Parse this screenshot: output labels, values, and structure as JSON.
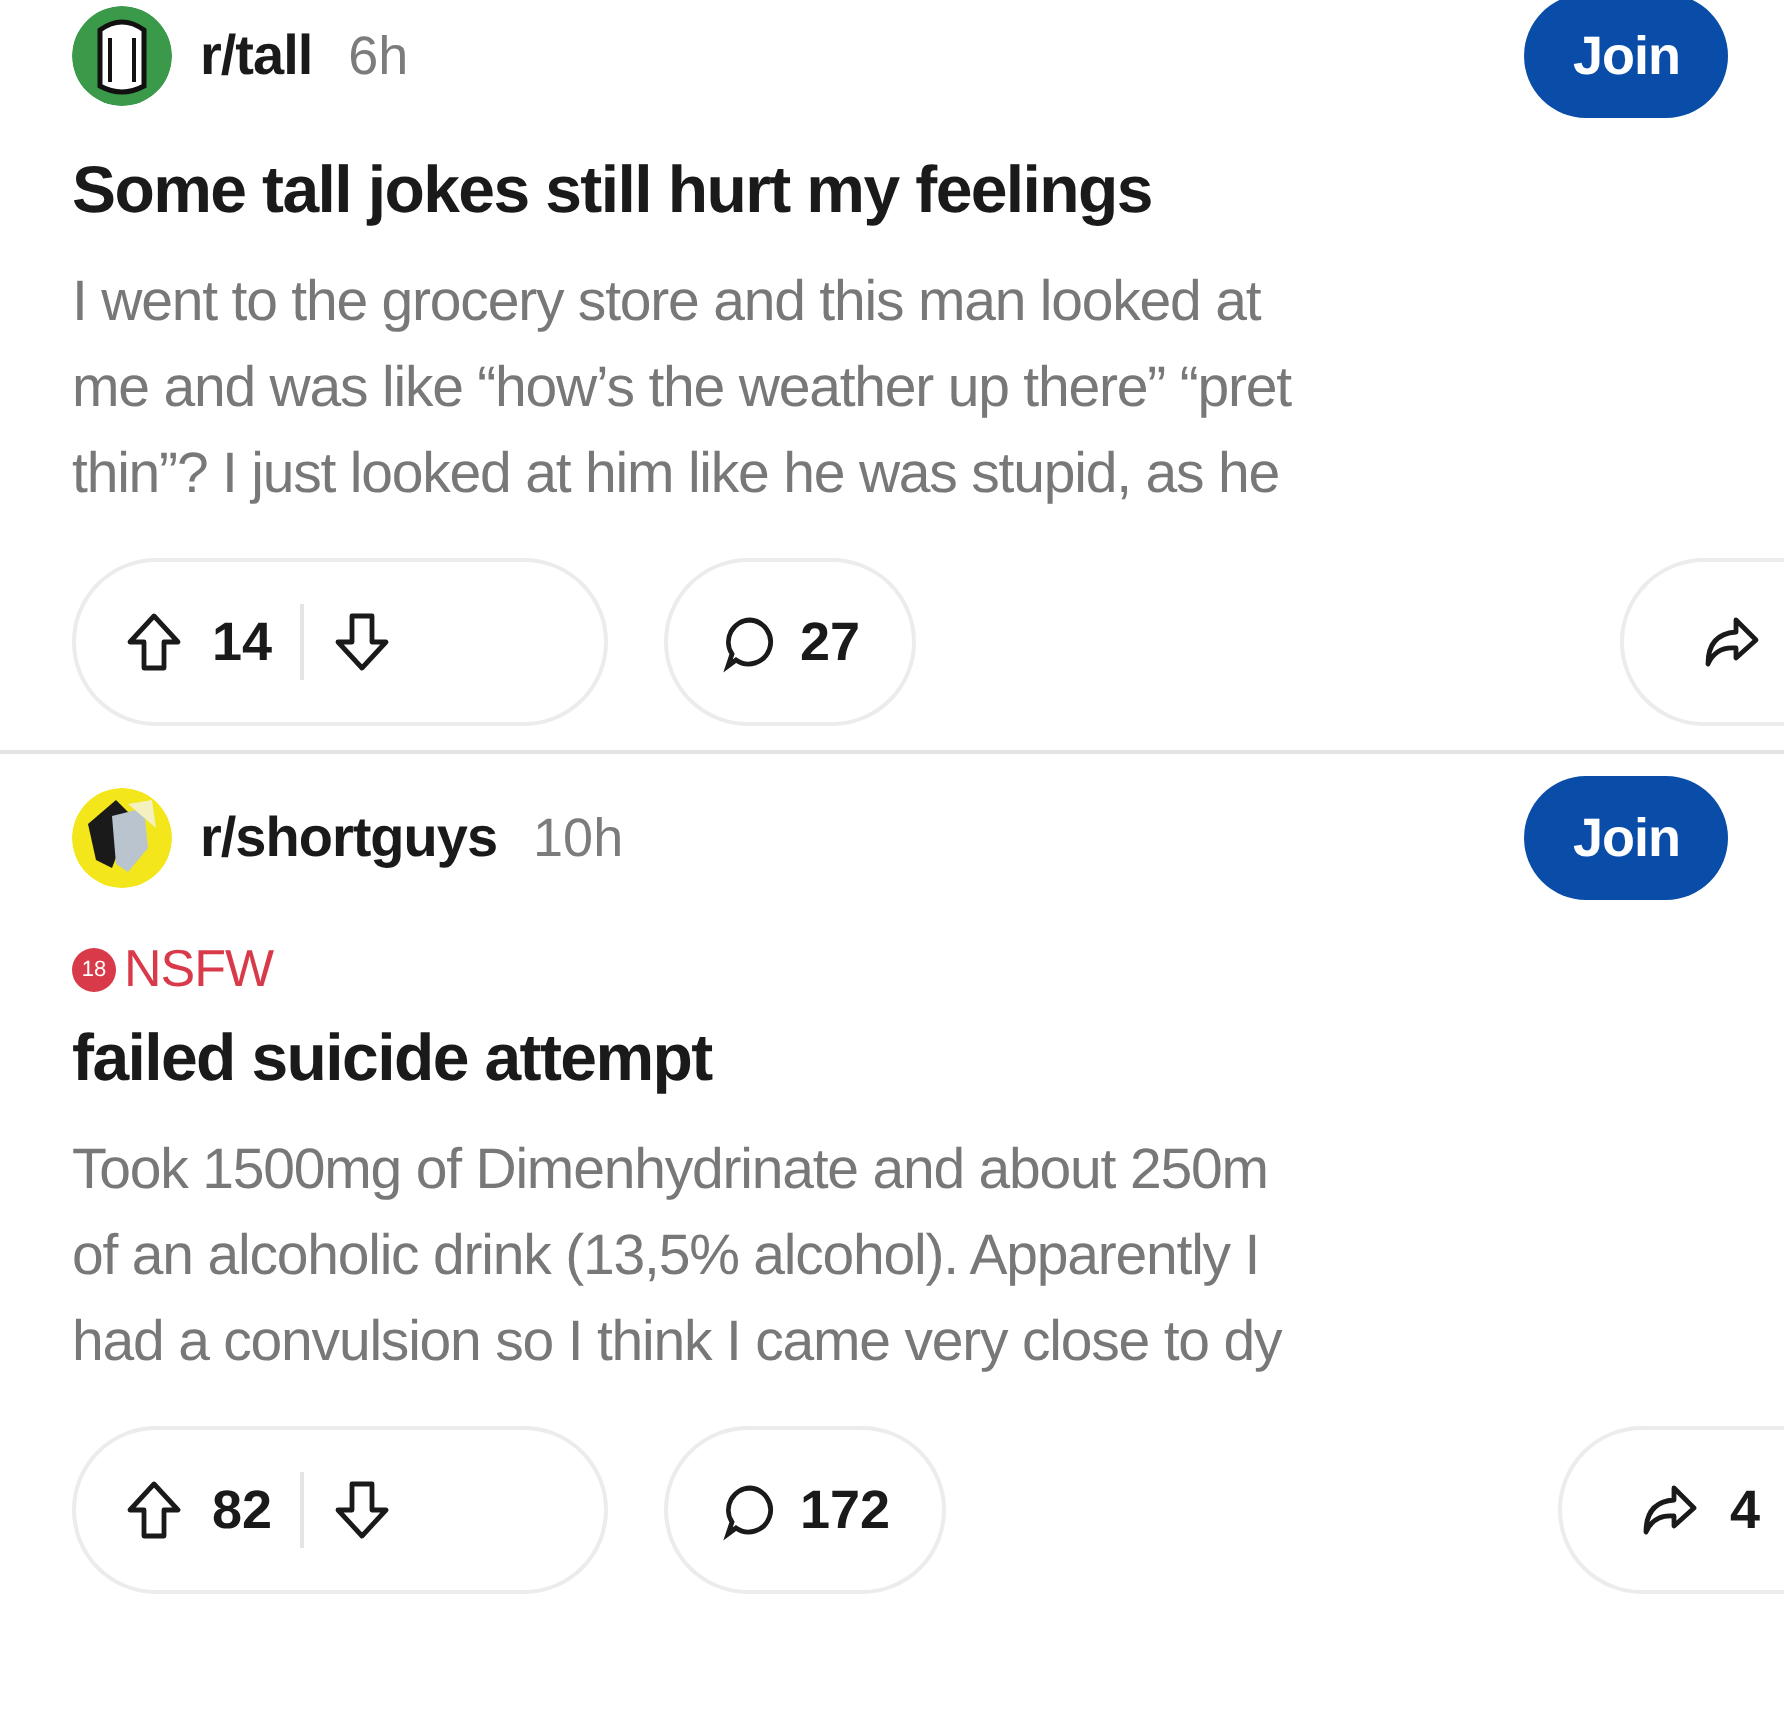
{
  "posts": [
    {
      "community": "r/tall",
      "age": "6h",
      "avatar": {
        "kind": "tall"
      },
      "join": "Join",
      "nsfw": false,
      "title": "Some tall jokes still hurt my feelings",
      "body_lines": [
        "I went to the grocery store and this man looked at",
        "me and was like “how’s the weather up there” “pret",
        "thin”? I just looked at him like he was stupid, as he"
      ],
      "upvotes": "14",
      "comments": "27"
    },
    {
      "community": "r/shortguys",
      "age": "10h",
      "avatar": {
        "kind": "short"
      },
      "join": "Join",
      "nsfw": true,
      "nsfw_badge": "18",
      "nsfw_label": "NSFW",
      "title": "failed suicide attempt",
      "body_lines": [
        "Took 1500mg of Dimenhydrinate and about 250m",
        "of an alcoholic drink (13,5% alcohol). Apparently I",
        "had a convulsion so I think I came very close to dy"
      ],
      "upvotes": "82",
      "comments": "172",
      "shares": "4"
    }
  ]
}
